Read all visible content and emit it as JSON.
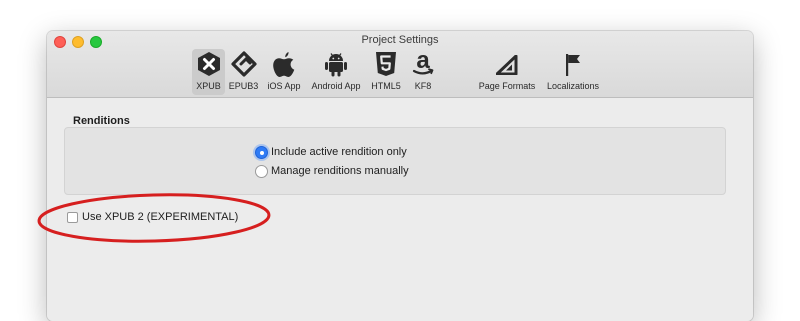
{
  "window": {
    "title": "Project Settings"
  },
  "toolbar": {
    "tabs": [
      {
        "label": "XPUB",
        "icon": "xpub-icon",
        "selected": true
      },
      {
        "label": "EPUB3",
        "icon": "epub-icon",
        "selected": false
      },
      {
        "label": "iOS App",
        "icon": "apple-icon",
        "selected": false
      },
      {
        "label": "Android App",
        "icon": "android-icon",
        "selected": false
      },
      {
        "label": "HTML5",
        "icon": "html5-icon",
        "selected": false
      },
      {
        "label": "KF8",
        "icon": "amazon-icon",
        "selected": false
      },
      {
        "label": "Page Formats",
        "icon": "set-square-icon",
        "selected": false
      },
      {
        "label": "Localizations",
        "icon": "flag-icon",
        "selected": false
      }
    ]
  },
  "renditions": {
    "title": "Renditions",
    "options": [
      {
        "label": "Include active rendition only",
        "selected": true
      },
      {
        "label": "Manage renditions manually",
        "selected": false
      }
    ]
  },
  "xpub2": {
    "label": "Use XPUB 2 (EXPERIMENTAL)",
    "checked": false
  },
  "colors": {
    "annotation": "#d61f1f",
    "accent": "#2f7bf5"
  }
}
